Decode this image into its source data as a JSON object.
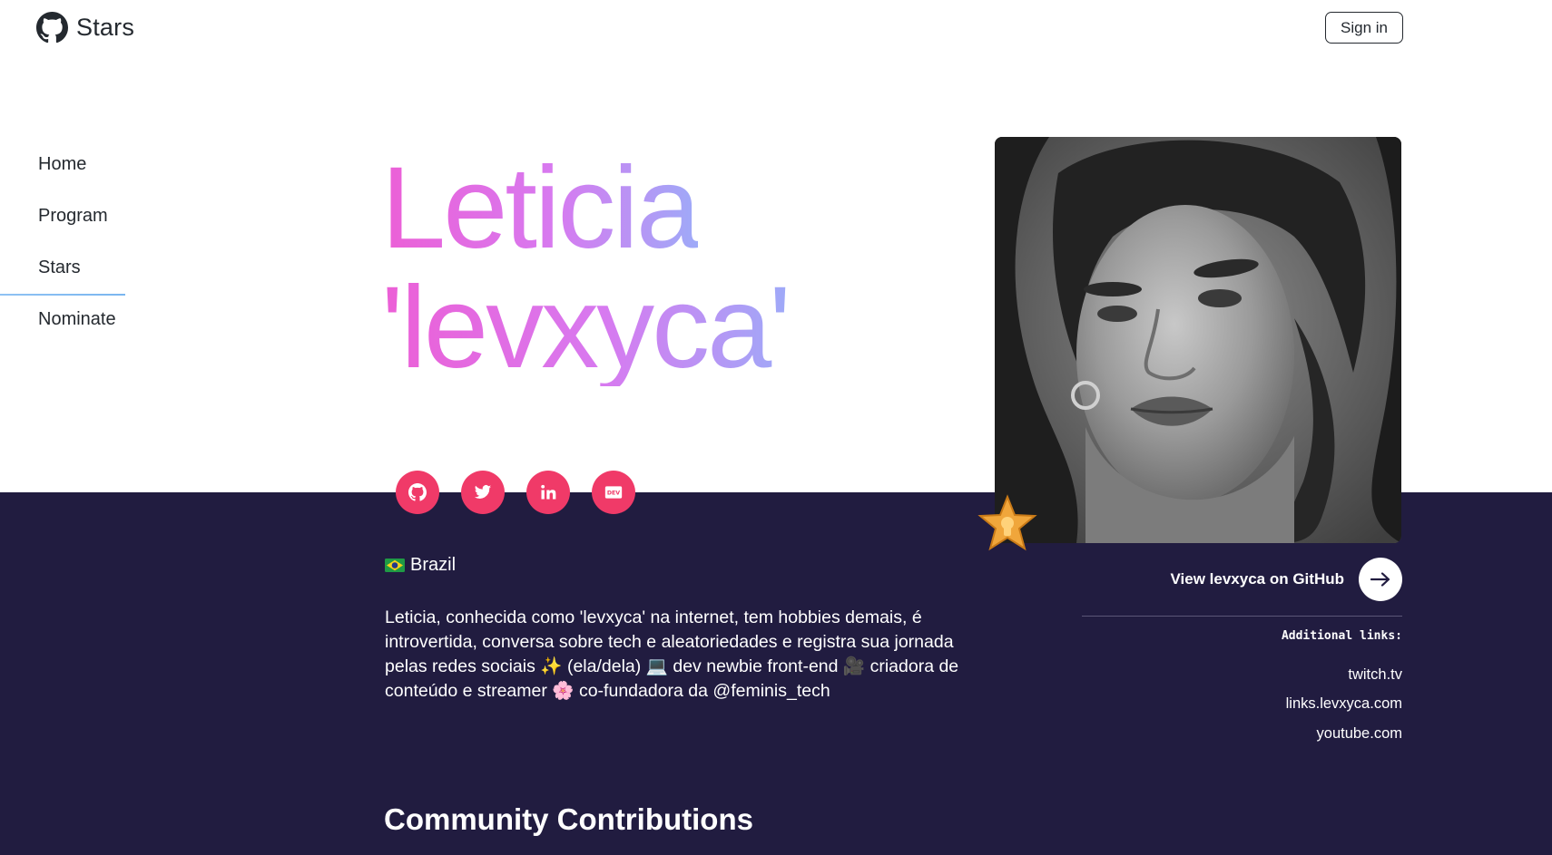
{
  "header": {
    "brand_title": "Stars",
    "logo_icon": "github-octocat-icon",
    "signin_label": "Sign in"
  },
  "sidebar": {
    "items": [
      {
        "label": "Home"
      },
      {
        "label": "Program"
      },
      {
        "label": "Stars",
        "active": true
      },
      {
        "label": "Nominate"
      }
    ]
  },
  "profile": {
    "name_line1": "Leticia",
    "name_line2": "'levxyca'",
    "country_flag_icon": "brazil-flag-icon",
    "country": "Brazil",
    "bio": "Leticia, conhecida como 'levxyca' na internet, tem hobbies demais, é introvertida, conversa sobre tech e aleatoriedades e registra sua jornada pelas redes sociais ✨ (ela/dela) 💻 dev newbie front-end 🎥 criadora de conteúdo e streamer 🌸 co-fundadora da @feminis_tech",
    "socials": [
      {
        "name": "github",
        "icon": "github-icon"
      },
      {
        "name": "twitter",
        "icon": "twitter-icon"
      },
      {
        "name": "linkedin",
        "icon": "linkedin-icon"
      },
      {
        "name": "dev",
        "icon": "dev-to-icon"
      }
    ],
    "view_github_label": "View levxyca on GitHub",
    "additional_links_title": "Additional links:",
    "additional_links": [
      "twitch.tv",
      "links.levxyca.com",
      "youtube.com"
    ]
  },
  "sections": {
    "community_title": "Community Contributions"
  },
  "colors": {
    "dark_band": "#211c40",
    "social_accent": "#f03a68",
    "name_gradient": [
      "#ec5fd6",
      "#d77af0",
      "#9eaaf8"
    ],
    "nav_active_underline": "#7ab6f0"
  }
}
